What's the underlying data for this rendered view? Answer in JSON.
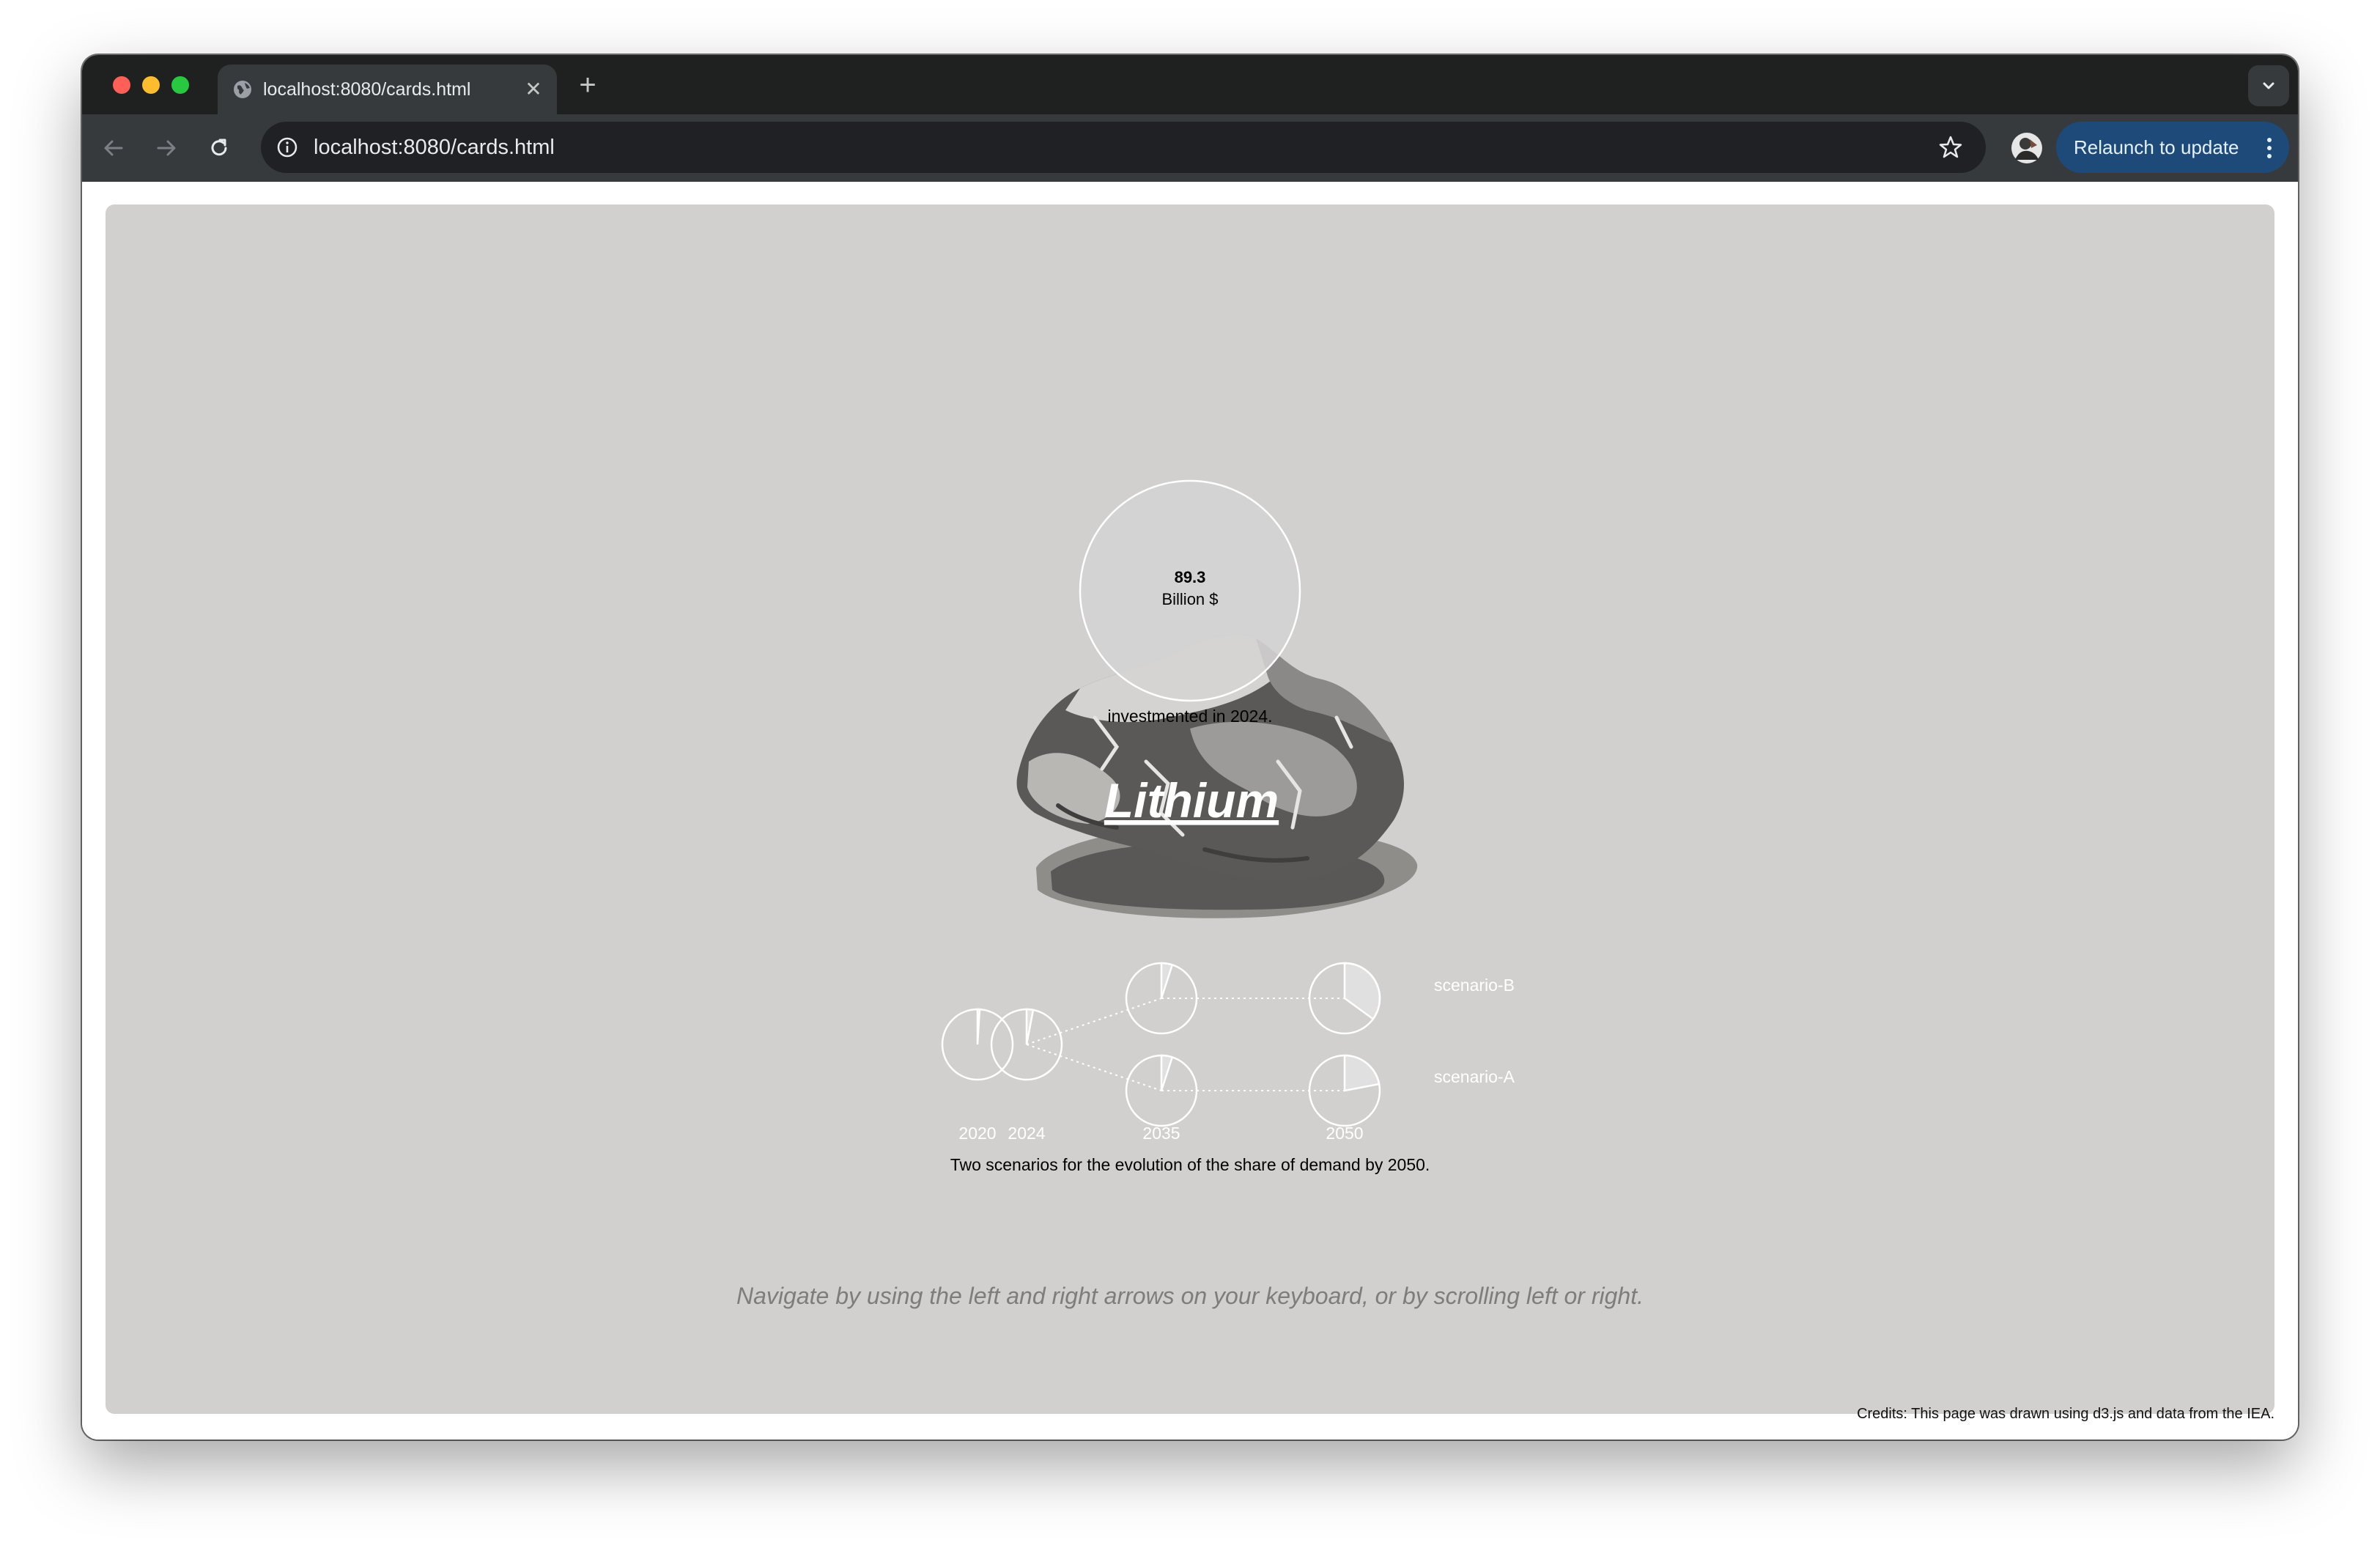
{
  "browser": {
    "tab_title": "localhost:8080/cards.html",
    "url": "localhost:8080/cards.html",
    "relaunch_label": "Relaunch to update",
    "icons": {
      "close": "close-icon",
      "new_tab": "plus-icon",
      "tab_menu": "chevron-down-icon",
      "back": "arrow-left-icon",
      "forward": "arrow-right-icon",
      "reload": "reload-icon",
      "site_info": "info-icon",
      "bookmark": "star-icon",
      "profile": "avatar",
      "more": "kebab-menu-icon",
      "favicon": "globe-icon"
    }
  },
  "card": {
    "investment_value": "89.3",
    "investment_unit": "Billion $",
    "investment_caption": "investmented in 2024.",
    "mineral_title": "Lithium",
    "chart_caption": "Two scenarios for the evolution of the share of demand by 2050.",
    "navigation_hint": "Navigate by using the left and right arrows on your keyboard, or by scrolling left or right."
  },
  "credits": "Credits: This page was drawn using d3.js and data from the IEA.",
  "colors": {
    "card_background": "#d1d0cf",
    "marks": "#ffffff",
    "hint_text": "#7d7d7d"
  },
  "chart_data": {
    "type": "pie",
    "description_labels": [
      "2020",
      "2024",
      "2035",
      "2050"
    ],
    "series": [
      {
        "name": "scenario-B",
        "x": [
          "2020",
          "2024",
          "2035",
          "2050"
        ],
        "values": [
          0.01,
          0.03,
          0.05,
          0.35
        ]
      },
      {
        "name": "scenario-A",
        "x": [
          "2020",
          "2024",
          "2035",
          "2050"
        ],
        "values": [
          0.01,
          0.03,
          0.05,
          0.22
        ]
      }
    ],
    "bubble": {
      "value": 89.3,
      "unit": "Billion $"
    }
  }
}
